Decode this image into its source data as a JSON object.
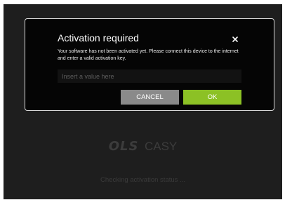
{
  "dialog": {
    "title": "Activation required",
    "message": "Your software has not been activated yet. Please connect this device to the internet and enter a valid activation key.",
    "input_placeholder": "Insert a value here",
    "input_value": "",
    "cancel_label": "CANCEL",
    "ok_label": "OK",
    "close_icon": "close-icon"
  },
  "background": {
    "brand_logo": "OLS",
    "brand_product": "CASY",
    "status": "Checking activation status ..."
  },
  "colors": {
    "screen_bg": "#1e1e1e",
    "dialog_bg": "#050505",
    "dialog_border": "#d8d8d8",
    "ok_button": "#8cc125",
    "cancel_button": "#8a8a8a",
    "muted_text": "#3c3c3c"
  }
}
